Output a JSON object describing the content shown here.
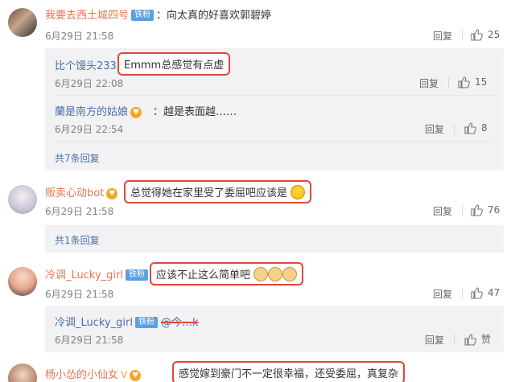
{
  "comments": [
    {
      "user": "我要去西土城四号",
      "badge": "铁粉",
      "text": "：向太真的好喜欢郭碧婷",
      "time": "6月29日 21:58",
      "reply": "回复",
      "likes": "25",
      "sub": [
        {
          "user": "比个馒头233",
          "highlight": "Emmm总感觉有点虚",
          "time": "6月29日 22:08",
          "reply": "回复",
          "likes": "15"
        },
        {
          "user": "蘭是南方的姑娘",
          "text": "：越是表面越……",
          "time": "6月29日 22:54",
          "reply": "回复",
          "likes": "8"
        }
      ],
      "more": "共7条回复"
    },
    {
      "user": "贩卖心动bot",
      "highlight": "总觉得她在家里受了委屈吧应该是",
      "time": "6月29日 21:58",
      "reply": "回复",
      "likes": "76",
      "more": "共1条回复"
    },
    {
      "user": "冷调_Lucky_girl",
      "badge": "铁粉",
      "highlight": "应该不止这么简单吧",
      "time": "6月29日 21:58",
      "reply": "回复",
      "likes": "47",
      "sub": [
        {
          "user": "冷调_Lucky_girl",
          "badge": "铁粉",
          "mention": "@今…k",
          "time": "6月29日 21:58",
          "reply": "回复",
          "likes": "赞"
        }
      ]
    },
    {
      "user": "杨小怂的小仙女",
      "highlight": "感觉嫁到豪门不一定很幸福，还受委屈，真复杂"
    }
  ]
}
